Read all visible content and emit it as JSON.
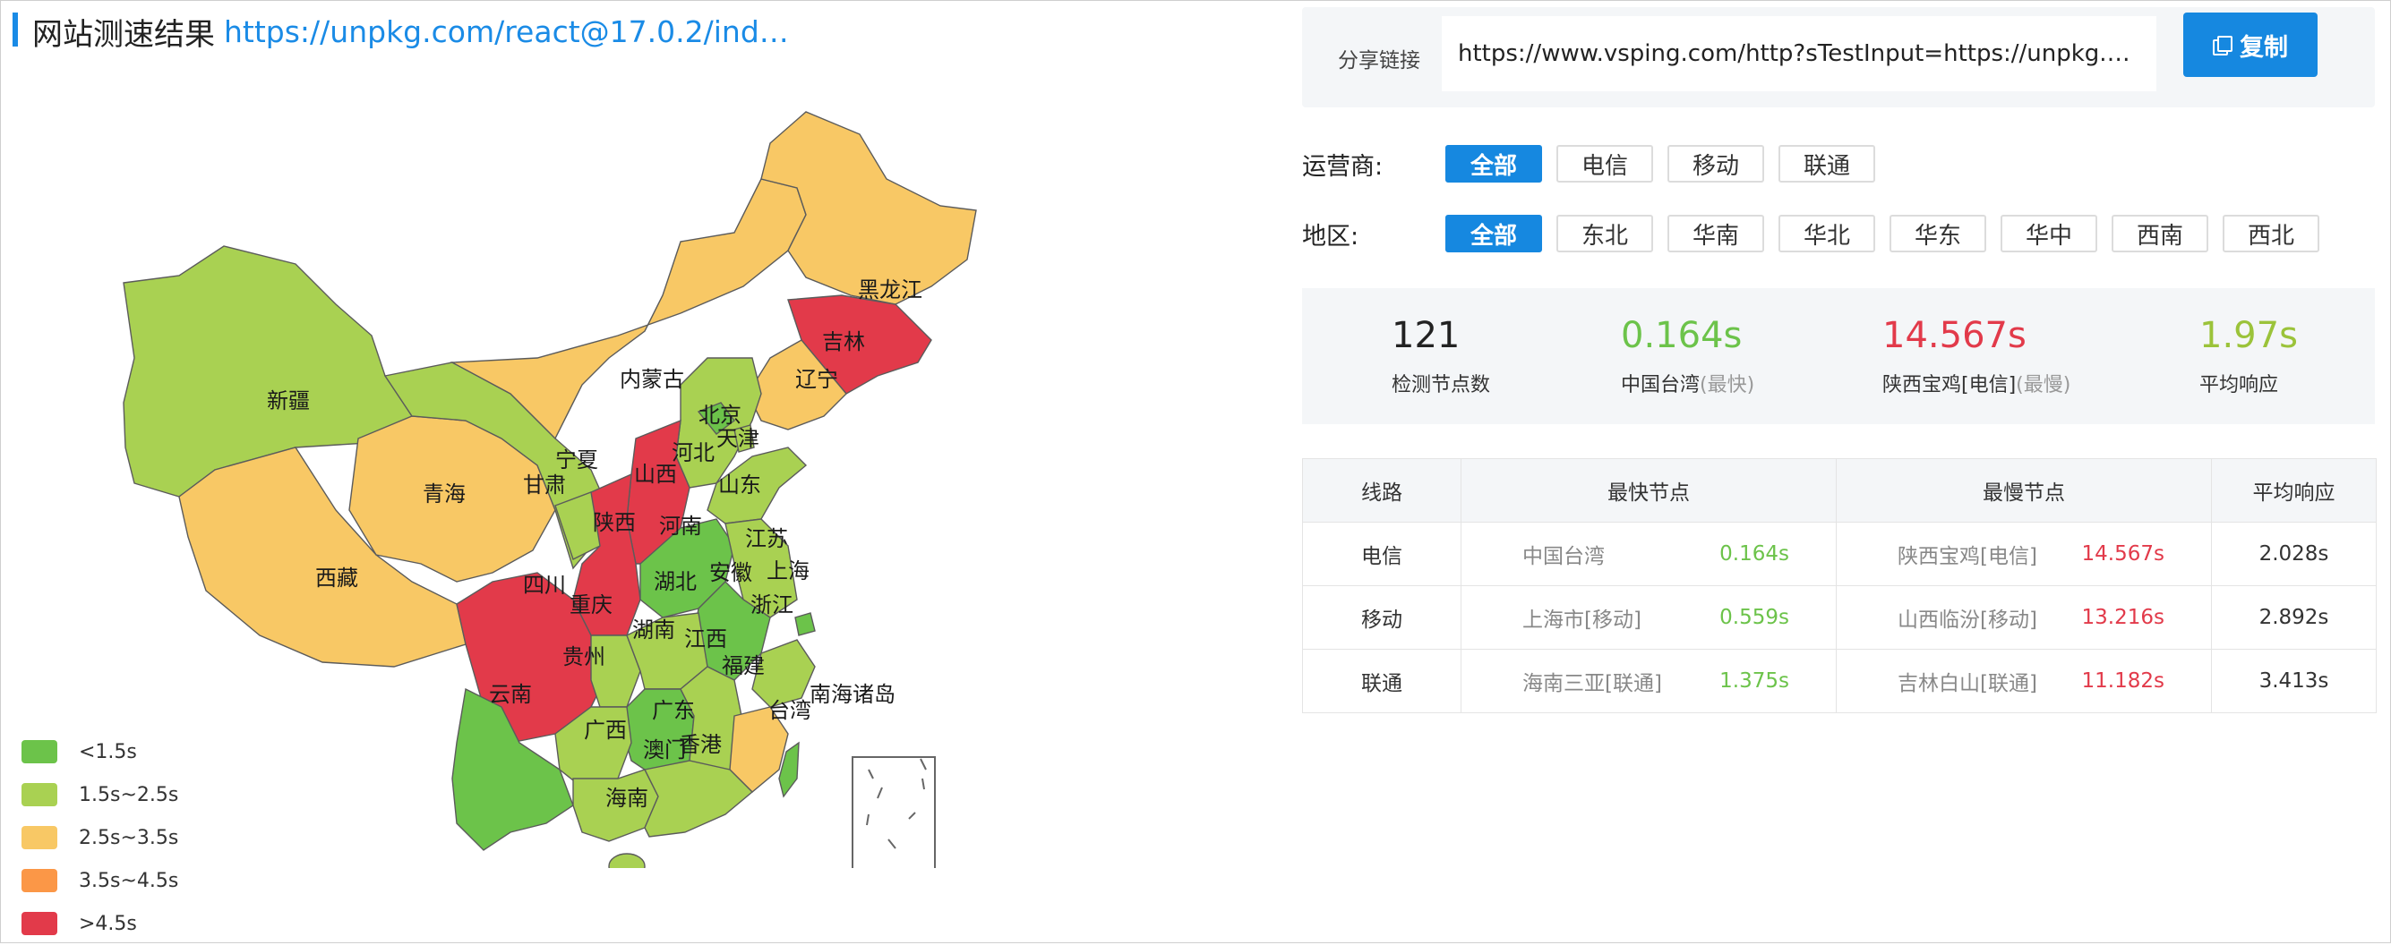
{
  "header": {
    "title": "网站测速结果",
    "url": "https://unpkg.com/react@17.0.2/inde…"
  },
  "share": {
    "label": "分享链接",
    "url": "https://www.vsping.com/http?sTestInput=https://unpkg.com…",
    "copy_label": "复制"
  },
  "filters": {
    "carrier_label": "运营商:",
    "carriers": [
      "全部",
      "电信",
      "移动",
      "联通"
    ],
    "region_label": "地区:",
    "regions": [
      "全部",
      "东北",
      "华南",
      "华北",
      "华东",
      "华中",
      "西南",
      "西北"
    ]
  },
  "summary": {
    "nodes_value": "121",
    "nodes_label": "检测节点数",
    "fastest_value": "0.164s",
    "fastest_label": "中国台湾",
    "fastest_tag": "(最快)",
    "slowest_value": "14.567s",
    "slowest_label": "陕西宝鸡[电信]",
    "slowest_tag": "(最慢)",
    "avg_value": "1.97s",
    "avg_label": "平均响应"
  },
  "table": {
    "headers": [
      "线路",
      "最快节点",
      "最慢节点",
      "平均响应"
    ],
    "rows": [
      {
        "line": "电信",
        "fast_node": "中国台湾",
        "fast_time": "0.164s",
        "slow_node": "陕西宝鸡[电信]",
        "slow_time": "14.567s",
        "avg": "2.028s"
      },
      {
        "line": "移动",
        "fast_node": "上海市[移动]",
        "fast_time": "0.559s",
        "slow_node": "山西临汾[移动]",
        "slow_time": "13.216s",
        "avg": "2.892s"
      },
      {
        "line": "联通",
        "fast_node": "海南三亚[联通]",
        "fast_time": "1.375s",
        "slow_node": "吉林白山[联通]",
        "slow_time": "11.182s",
        "avg": "3.413s"
      }
    ]
  },
  "legend": [
    {
      "label": "<1.5s",
      "color": "#6cc34a"
    },
    {
      "label": "1.5s~2.5s",
      "color": "#a9d152"
    },
    {
      "label": "2.5s~3.5s",
      "color": "#f8c865"
    },
    {
      "label": "3.5s~4.5s",
      "color": "#fb9747"
    },
    {
      "label": ">4.5s",
      "color": "#e23a4a"
    }
  ],
  "map": {
    "provinces": [
      "黑龙江",
      "吉林",
      "辽宁",
      "内蒙古",
      "新疆",
      "北京",
      "天津",
      "河北",
      "宁夏",
      "甘肃",
      "山西",
      "山东",
      "青海",
      "陕西",
      "河南",
      "江苏",
      "西藏",
      "四川",
      "湖北",
      "安徽",
      "上海",
      "重庆",
      "浙江",
      "湖南",
      "江西",
      "贵州",
      "福建",
      "云南",
      "广东",
      "南海诸岛",
      "台湾",
      "广西",
      "香港",
      "澳门",
      "海南"
    ]
  }
}
